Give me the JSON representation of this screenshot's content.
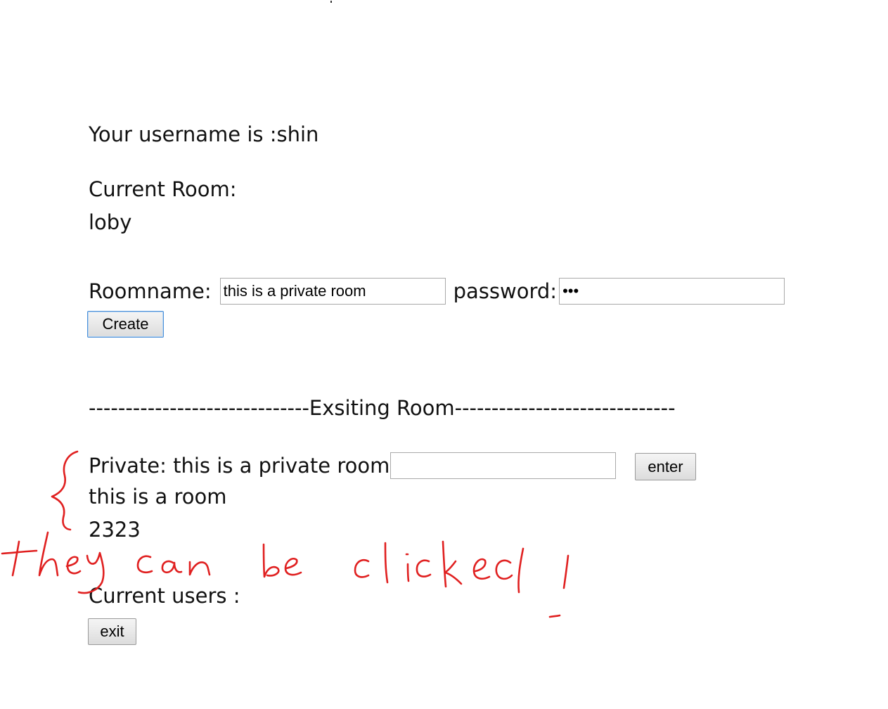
{
  "header": {
    "username_line": "Your username is :shin"
  },
  "current_room": {
    "label": "Current Room:",
    "value": "loby"
  },
  "create_form": {
    "roomname_label": "Roomname:",
    "roomname_value": "this is a private room",
    "password_label": "password:",
    "password_value": "abc",
    "create_label": "Create"
  },
  "existing_rooms": {
    "divider": "------------------------------Exsiting Room------------------------------",
    "rooms": [
      {
        "label": "Private: this is a private room",
        "password_value": "",
        "enter_label": "enter"
      },
      {
        "label": "this is a room"
      },
      {
        "label": "2323"
      }
    ]
  },
  "users": {
    "label": "Current users :",
    "exit_label": "exit"
  },
  "annotation": {
    "handwritten_note": "they can be clicked !",
    "ink_color": "#e02020"
  }
}
